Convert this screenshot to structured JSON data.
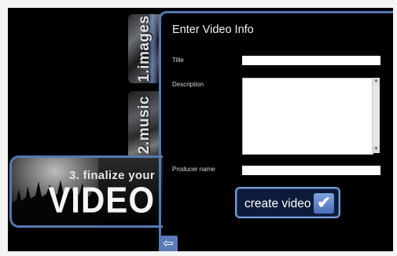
{
  "wizard": {
    "step1_label": "1.images",
    "step2_label": "2.music",
    "step3_label": "3. finalize your",
    "step3_big": "VIDEO",
    "back_icon": "⇦"
  },
  "form": {
    "title": "Enter Video Info",
    "title_label": "Title",
    "title_value": "",
    "description_label": "Description",
    "description_value": "",
    "producer_label": "Producer name",
    "producer_value": "",
    "create_label": "create video",
    "check_icon": "✔"
  },
  "colors": {
    "accent_border": "#5878b4",
    "button_bg": "#0d1b3a"
  }
}
